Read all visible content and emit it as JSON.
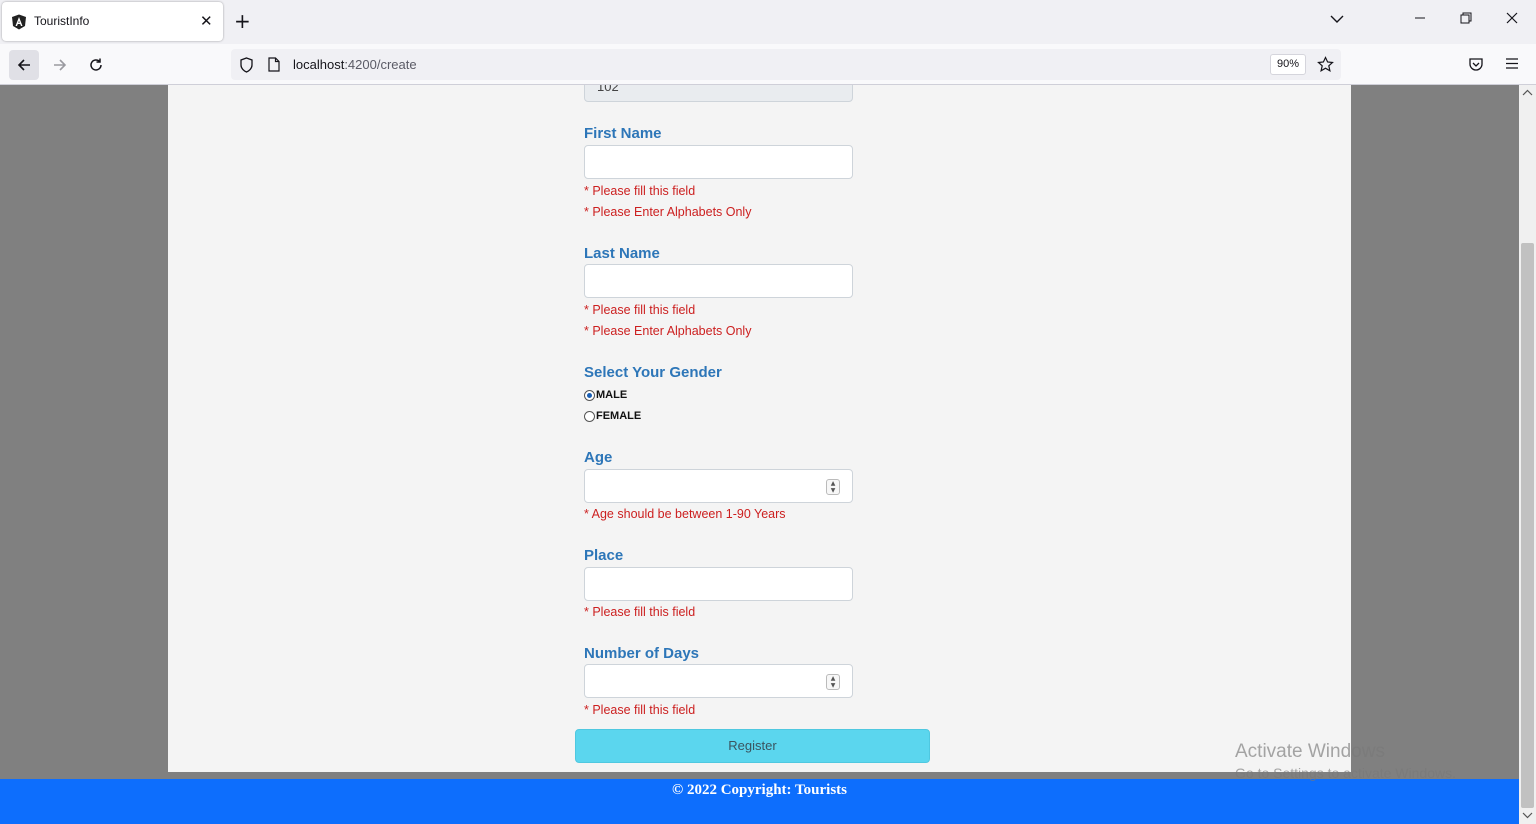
{
  "browser": {
    "tab_title": "TouristInfo",
    "url_host": "localhost",
    "url_path": ":4200/create",
    "zoom": "90%"
  },
  "form": {
    "select_value": "102",
    "first_name": {
      "label": "First Name",
      "errors": [
        "* Please fill this field",
        "* Please Enter Alphabets Only"
      ]
    },
    "last_name": {
      "label": "Last Name",
      "errors": [
        "* Please fill this field",
        "* Please Enter Alphabets Only"
      ]
    },
    "gender": {
      "label": "Select Your Gender",
      "options": [
        "MALE",
        "FEMALE"
      ],
      "selected": "MALE"
    },
    "age": {
      "label": "Age",
      "errors": [
        "* Age should be between 1-90 Years"
      ]
    },
    "place": {
      "label": "Place",
      "errors": [
        "* Please fill this field"
      ]
    },
    "days": {
      "label": "Number of Days",
      "errors": [
        "* Please fill this field"
      ]
    },
    "register_label": "Register"
  },
  "footer": {
    "text": "© 2022 Copyright: Tourists"
  },
  "watermark": {
    "line1": "Activate Windows",
    "line2": "Go to Settings to activate Windows."
  },
  "colors": {
    "accent": "#2d76b8",
    "error": "#cc1f1f",
    "button": "#5bd6ee",
    "footer": "#0d6efd"
  }
}
